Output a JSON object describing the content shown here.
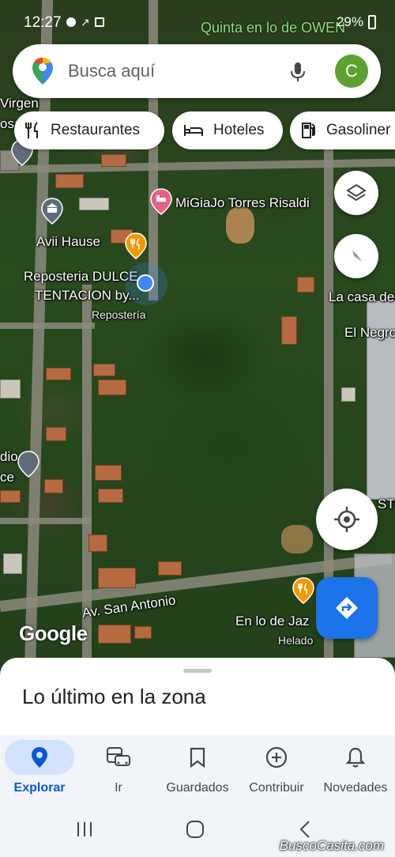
{
  "status_bar": {
    "time": "12:27",
    "battery": "29%",
    "place_overlay": "Quinta en lo de OWEN"
  },
  "search": {
    "placeholder": "Busca aquí",
    "avatar_letter": "C"
  },
  "chips": [
    {
      "label": "Restaurantes",
      "icon": "fork-knife-icon"
    },
    {
      "label": "Hoteles",
      "icon": "bed-icon"
    },
    {
      "label": "Gasoliner",
      "icon": "gas-station-icon"
    }
  ],
  "map_labels": {
    "top_left": "Virgen",
    "top_left_2": "osa",
    "hotel": "MiGiaJo Torres Risaldi",
    "avii": "Avii Hause",
    "reposteria_1": "Reposteria DULCE",
    "reposteria_2": "TENTACION by...",
    "reposteria_cat": "Repostería",
    "la_casa": "La casa de",
    "el_negro": "El Negro",
    "left_mid_1": "dio",
    "left_mid_2": "ce",
    "street": "Av. San Antonio",
    "jaz": "En lo de Jaz",
    "jaz_cat": "Helado",
    "right_partial": "STE"
  },
  "logo": "Google",
  "sheet": {
    "title": "Lo último en la zona"
  },
  "bottom_nav": [
    {
      "label": "Explorar",
      "icon": "location-pin-icon",
      "active": true
    },
    {
      "label": "Ir",
      "icon": "commute-icon",
      "active": false
    },
    {
      "label": "Guardados",
      "icon": "bookmark-icon",
      "active": false
    },
    {
      "label": "Contribuir",
      "icon": "add-circle-icon",
      "active": false
    },
    {
      "label": "Novedades",
      "icon": "bell-icon",
      "active": false
    }
  ],
  "watermark": "BuscoCasita.com",
  "colors": {
    "accent": "#1a73e8",
    "active_nav_bg": "#d3e3fd",
    "avatar": "#5da12f"
  }
}
